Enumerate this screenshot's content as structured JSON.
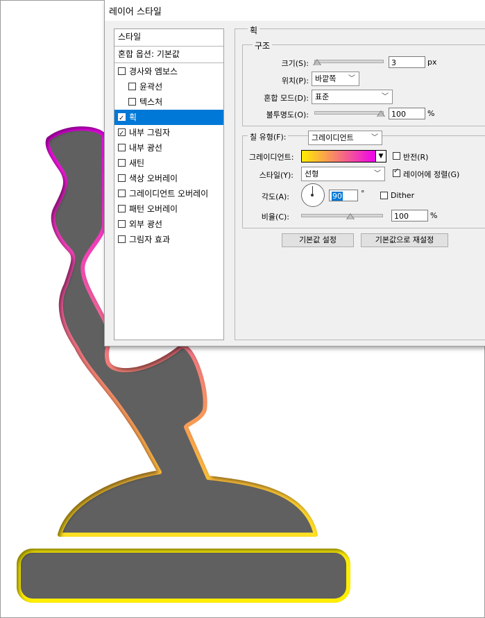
{
  "dialog": {
    "title": "레이어 스타일"
  },
  "style_list": {
    "header": "스타일",
    "blend_options": "혼합 옵션: 기본값",
    "items": [
      {
        "label": "경사와 엠보스",
        "checked": false
      },
      {
        "label": "윤곽선",
        "checked": false
      },
      {
        "label": "텍스처",
        "checked": false
      },
      {
        "label": "획",
        "checked": true
      },
      {
        "label": "내부 그림자",
        "checked": true
      },
      {
        "label": "내부 광선",
        "checked": false
      },
      {
        "label": "새틴",
        "checked": false
      },
      {
        "label": "색상 오버레이",
        "checked": false
      },
      {
        "label": "그레이디언트 오버레이",
        "checked": false
      },
      {
        "label": "패턴 오버레이",
        "checked": false
      },
      {
        "label": "외부 광선",
        "checked": false
      },
      {
        "label": "그림자 효과",
        "checked": false
      }
    ]
  },
  "stroke": {
    "section_title": "획",
    "structure_title": "구조",
    "size_label": "크기(S):",
    "size_value": "3",
    "size_unit": "px",
    "position_label": "위치(P):",
    "position_value": "바깥쪽",
    "blend_mode_label": "혼합 모드(D):",
    "blend_mode_value": "표준",
    "opacity_label": "불투명도(O):",
    "opacity_value": "100",
    "opacity_unit": "%",
    "fill_type_label": "칠 유형(F):",
    "fill_type_value": "그레이디언트",
    "gradient_label": "그레이디언트:",
    "reverse_label": "반전(R)",
    "reverse_checked": false,
    "style_label": "스타일(Y):",
    "style_value": "선형",
    "align_label": "레이어에 정렬(G)",
    "align_checked": true,
    "angle_label": "각도(A):",
    "angle_value": "90",
    "angle_unit": "°",
    "dither_label": "Dither",
    "dither_checked": false,
    "scale_label": "비율(C):",
    "scale_value": "100",
    "scale_unit": "%",
    "reset_default_button": "기본값 설정",
    "reset_to_default_button": "기본값으로 재설정",
    "gradient_colors": [
      "#ffee00",
      "#ee00ee"
    ]
  },
  "colors": {
    "selection": "#0078d7",
    "shape_fill": "#616161",
    "stroke_magenta": "#ee00ee",
    "stroke_yellow": "#ffee00"
  }
}
